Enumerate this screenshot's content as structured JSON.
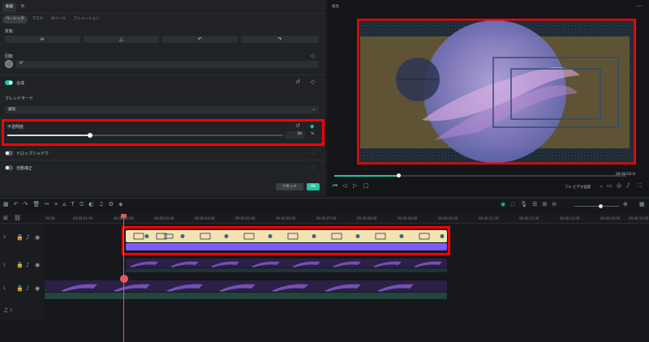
{
  "left_panel": {
    "tabs": [
      "動画",
      "色"
    ],
    "subtabs": [
      "ベーシック",
      "マスク",
      "AIツール",
      "アニメーション"
    ],
    "flip_label": "反転",
    "rotate_label": "回転",
    "rotate_value": "0°",
    "composite_label": "合成",
    "blend_mode_label": "ブレンドモード",
    "blend_mode_value": "通常",
    "opacity_label": "不透明度",
    "opacity_value": "30",
    "opacity_unit": "%",
    "opacity_fraction": 0.3,
    "drop_shadow_label": "ドロップシャドウ",
    "auto_enhance_label": "自動補正",
    "reset_label": "リセット",
    "ok_label": "OK"
  },
  "preview": {
    "title": "再生",
    "timecode": "00:00:02:0",
    "quality_label": "フル ビデオ画質",
    "progress_fraction": 0.22
  },
  "timeline": {
    "ruler_labels": [
      "00:00",
      "00:00:01:00",
      "00:00:02:00",
      "00:00:03:00",
      "00:00:04:00",
      "00:00:05:00",
      "00:00:06:00",
      "00:00:07:00",
      "00:00:08:00",
      "00:00:09:00",
      "00:00:10:00",
      "00:00:11:00",
      "00:00:12:00",
      "00:00:13:00",
      "00:00:14:00",
      "00:00:15:00"
    ],
    "track_labels": [
      "3",
      "2",
      "1",
      "1"
    ]
  },
  "colors": {
    "accent": "#21c5a6",
    "highlight_box": "#ff0000",
    "sticker_bg": "#f2e3b0",
    "purple_bar": "#7d5cff",
    "playhead": "#e45a5a"
  }
}
